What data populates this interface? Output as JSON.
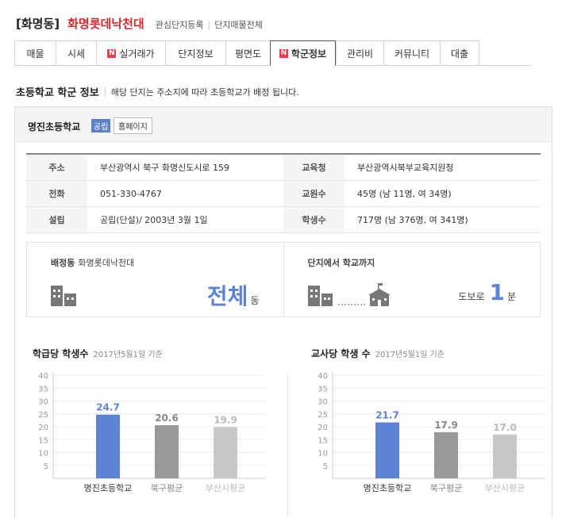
{
  "header": {
    "dong": "[화명동]",
    "apt_name": "화명롯데낙천대",
    "links": [
      "관심단지등록",
      "단지매물전체"
    ]
  },
  "tabs": [
    {
      "label": "매물",
      "badge": ""
    },
    {
      "label": "시세",
      "badge": ""
    },
    {
      "label": "실거래가",
      "badge": "N"
    },
    {
      "label": "단지정보",
      "badge": ""
    },
    {
      "label": "평면도",
      "badge": ""
    },
    {
      "label": "학군정보",
      "badge": "N",
      "active": true
    },
    {
      "label": "관리비",
      "badge": ""
    },
    {
      "label": "커뮤니티",
      "badge": ""
    },
    {
      "label": "대출",
      "badge": ""
    }
  ],
  "section": {
    "title": "초등학교 학군 정보",
    "desc": "해당 단지는 주소지에 따라 초등학교가 배정 됩니다."
  },
  "school": {
    "name": "명진초등학교",
    "type_badge": "공립",
    "homepage_button": "홈페이지",
    "rows": [
      {
        "l1": "주소",
        "v1": "부산광역시 북구 화명신도시로 159",
        "l2": "교육청",
        "v2": "부산광역시북부교육지원청"
      },
      {
        "l1": "전화",
        "v1": "051-330-4767",
        "l2": "교원수",
        "v2": "45명 (남 11명, 여 34명)"
      },
      {
        "l1": "설립",
        "v1": "공립(단설)/ 2003년 3월 1일",
        "l2": "학생수",
        "v2": "717명 (남 376명, 여 341명)"
      }
    ]
  },
  "assign": {
    "title": "배정동",
    "apt": "화명롯데낙천대",
    "value": "전체",
    "unit": "동"
  },
  "distance": {
    "title": "단지에서 학교까지",
    "prefix": "도보로",
    "value": "1",
    "unit": "분"
  },
  "colors": {
    "accent": "#5c83d4",
    "gray": "#999999",
    "light": "#c8c8c8",
    "red": "#d9262b"
  },
  "chart_data": [
    {
      "type": "bar",
      "title": "학급당 학생수",
      "subtitle": "2017년5월1일 기준",
      "categories": [
        "명진초등학교",
        "북구평균",
        "부산시평균"
      ],
      "values": [
        24.7,
        20.6,
        19.9
      ],
      "value_labels": [
        "24.7",
        "20.6",
        "19.9"
      ],
      "y_ticks": [
        "40",
        "35",
        "30",
        "25",
        "20",
        "15",
        "10",
        "5"
      ],
      "ylim": [
        0,
        40
      ]
    },
    {
      "type": "bar",
      "title": "교사당 학생 수",
      "subtitle": "2017년5월1일 기준",
      "categories": [
        "명진초등학교",
        "북구평균",
        "부산시평균"
      ],
      "values": [
        21.7,
        17.9,
        17.0
      ],
      "value_labels": [
        "21.7",
        "17.9",
        "17.0"
      ],
      "y_ticks": [
        "40",
        "35",
        "30",
        "25",
        "20",
        "15",
        "10",
        "5"
      ],
      "ylim": [
        0,
        40
      ]
    }
  ]
}
